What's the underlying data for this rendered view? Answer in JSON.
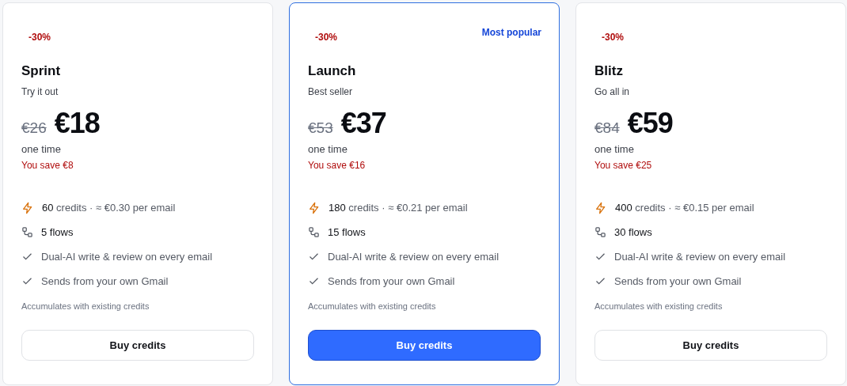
{
  "plans": [
    {
      "discount": "-30%",
      "name": "Sprint",
      "tagline": "Try it out",
      "old_price": "€26",
      "price": "€18",
      "period": "one time",
      "savings": "You save €8",
      "selected": false,
      "features": [
        {
          "kind": "credits",
          "amount": "60",
          "text": "credits · ≈ €0.30 per email"
        },
        {
          "kind": "flows",
          "text": "5 flows"
        },
        {
          "kind": "check",
          "text": "Dual-AI write & review on every email"
        },
        {
          "kind": "check",
          "text": "Sends from your own Gmail"
        }
      ],
      "note": "Accumulates with existing credits",
      "button": "Buy credits"
    },
    {
      "discount": "-30%",
      "badge": "Most popular",
      "name": "Launch",
      "tagline": "Best seller",
      "old_price": "€53",
      "price": "€37",
      "period": "one time",
      "savings": "You save €16",
      "selected": true,
      "features": [
        {
          "kind": "credits",
          "amount": "180",
          "text": "credits · ≈ €0.21 per email"
        },
        {
          "kind": "flows",
          "text": "15 flows"
        },
        {
          "kind": "check",
          "text": "Dual-AI write & review on every email"
        },
        {
          "kind": "check",
          "text": "Sends from your own Gmail"
        }
      ],
      "note": "Accumulates with existing credits",
      "button": "Buy credits"
    },
    {
      "discount": "-30%",
      "name": "Blitz",
      "tagline": "Go all in",
      "old_price": "€84",
      "price": "€59",
      "period": "one time",
      "savings": "You save €25",
      "selected": false,
      "features": [
        {
          "kind": "credits",
          "amount": "400",
          "text": "credits · ≈ €0.15 per email"
        },
        {
          "kind": "flows",
          "text": "30 flows"
        },
        {
          "kind": "check",
          "text": "Dual-AI write & review on every email"
        },
        {
          "kind": "check",
          "text": "Sends from your own Gmail"
        }
      ],
      "note": "Accumulates with existing credits",
      "button": "Buy credits"
    }
  ]
}
